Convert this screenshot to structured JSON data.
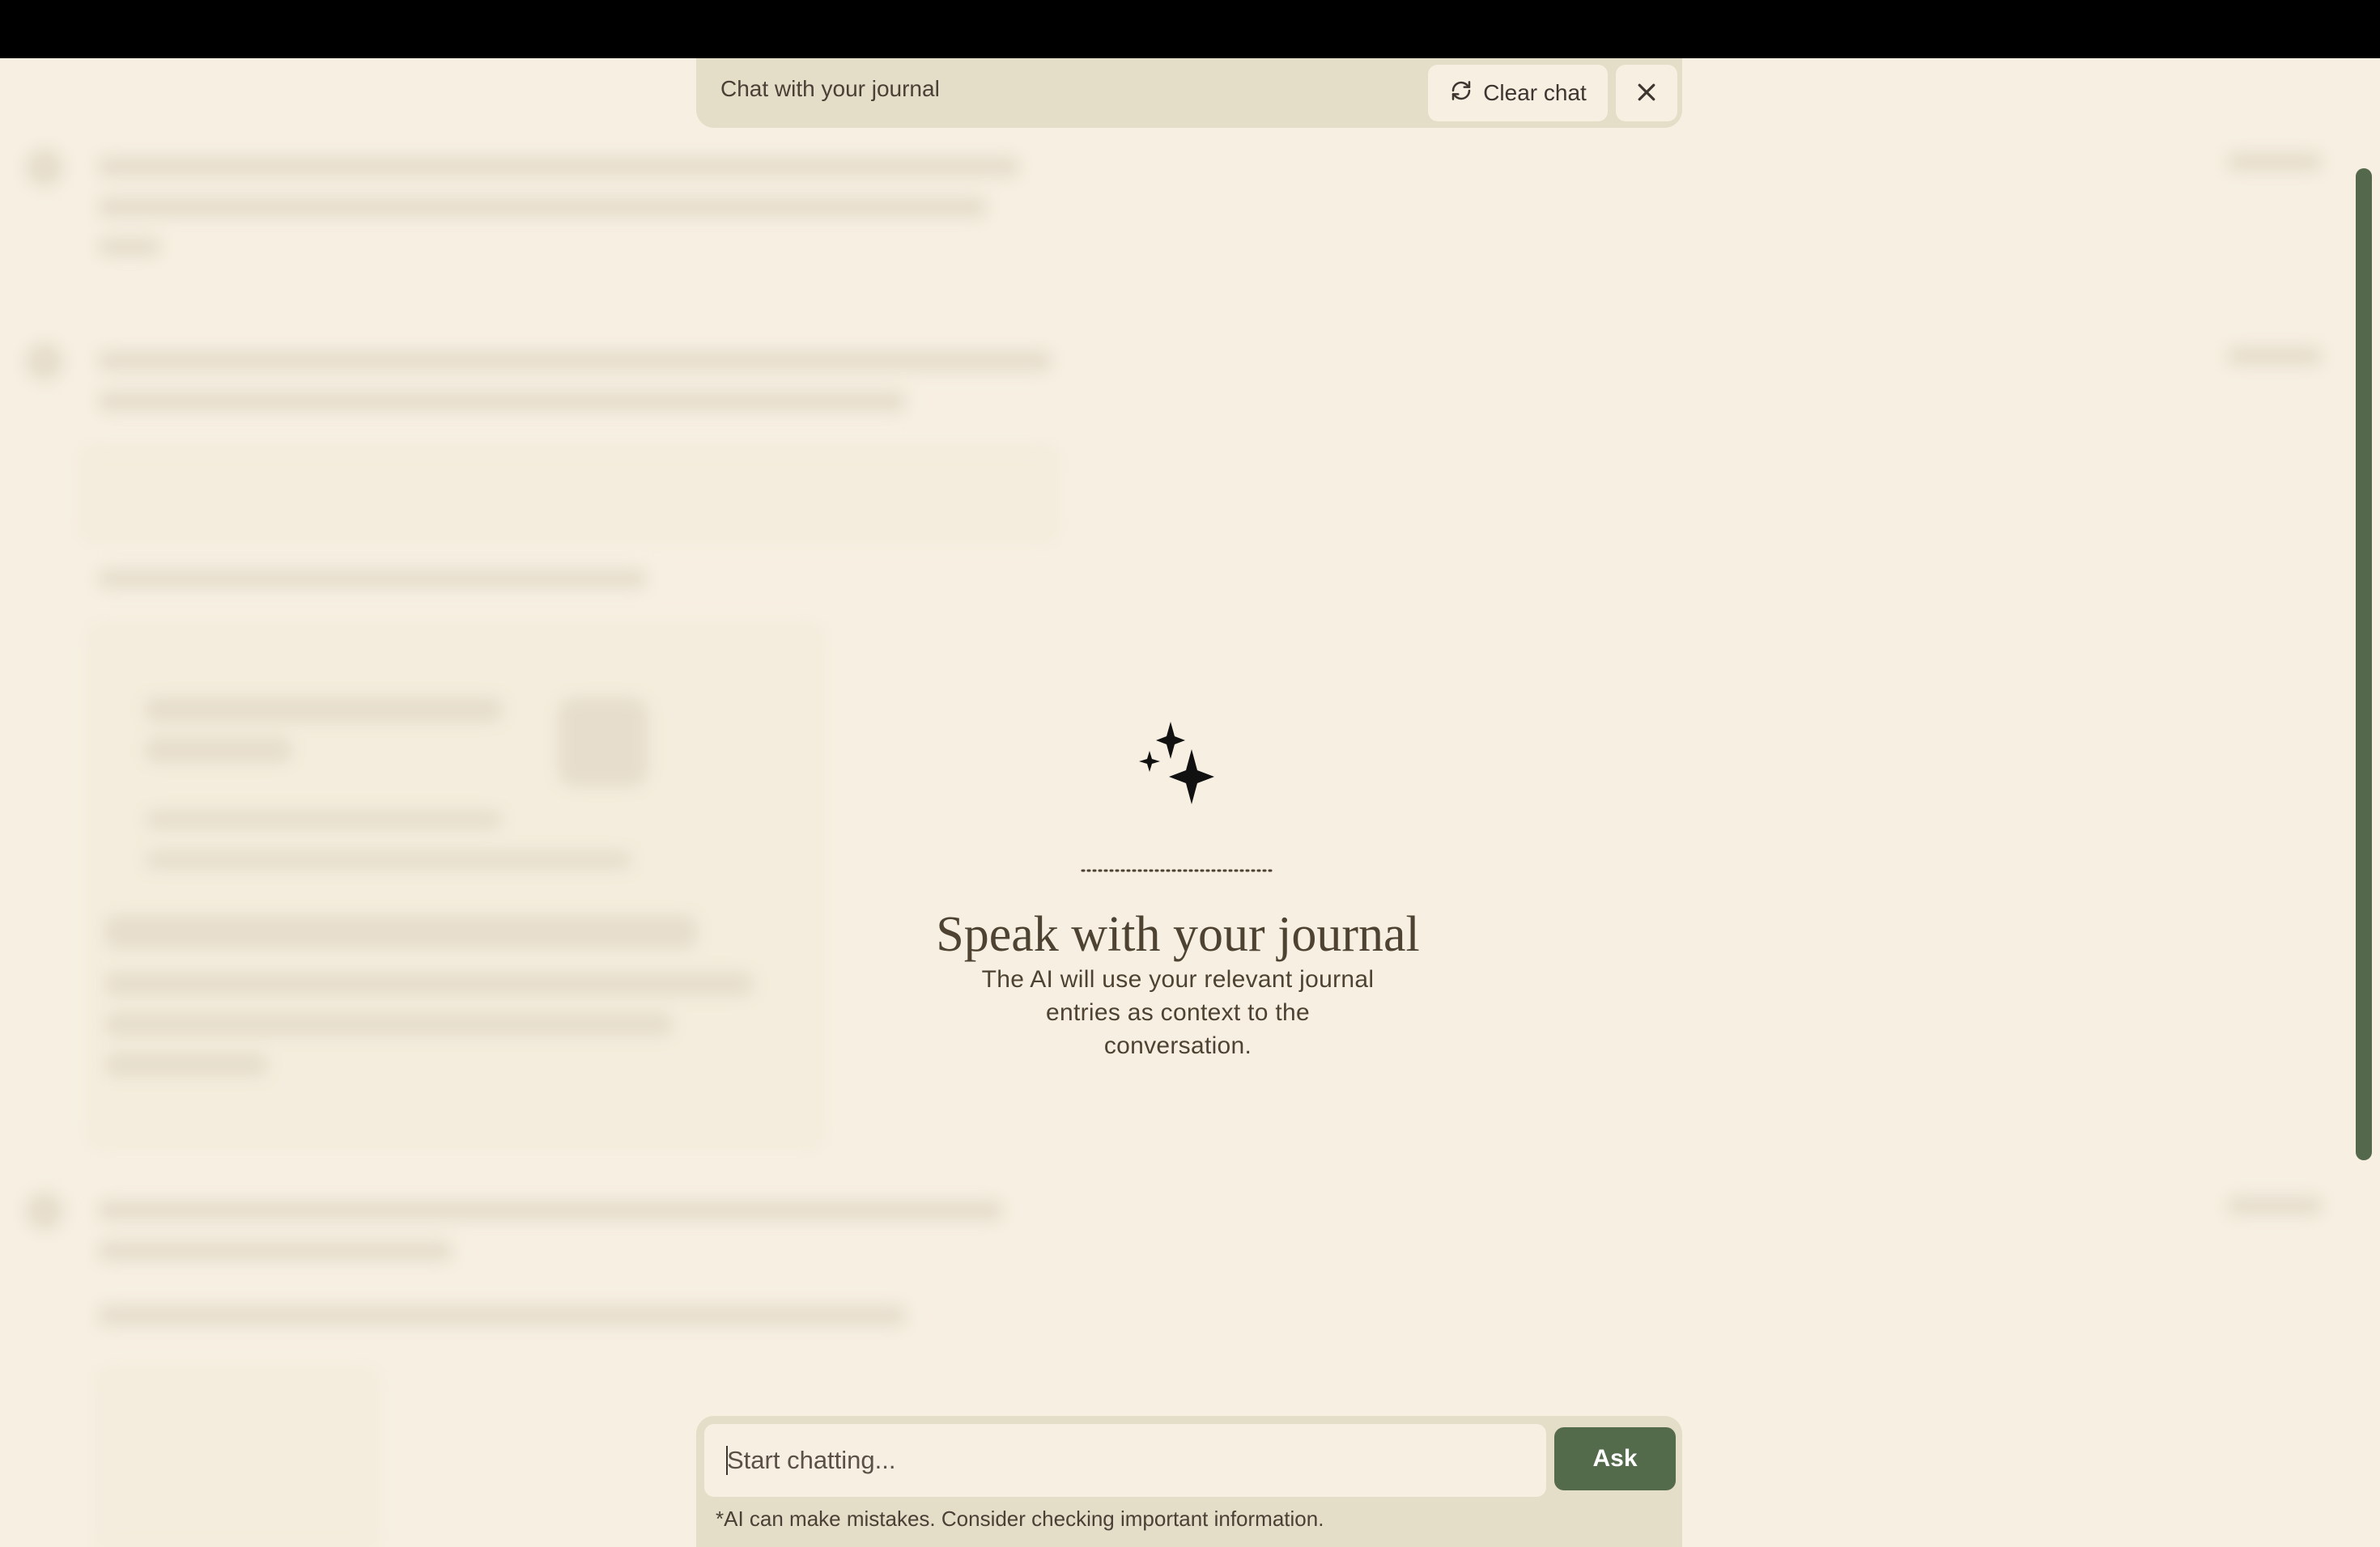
{
  "header": {
    "title": "Chat with your journal",
    "clear_label": "Clear chat"
  },
  "empty_state": {
    "headline": "Speak with your journal",
    "subtitle": "The AI will use your relevant journal entries as context to the conversation."
  },
  "composer": {
    "placeholder": "Start chatting...",
    "ask_label": "Ask",
    "disclaimer": "*AI can make mistakes. Consider checking important information."
  },
  "colors": {
    "background": "#f7f0e2",
    "panel": "#e4ddc7",
    "accent": "#536a4b",
    "text": "#4e4232"
  },
  "icons": {
    "clear": "refresh-icon",
    "close": "close-icon",
    "hero": "sparkles-icon"
  }
}
